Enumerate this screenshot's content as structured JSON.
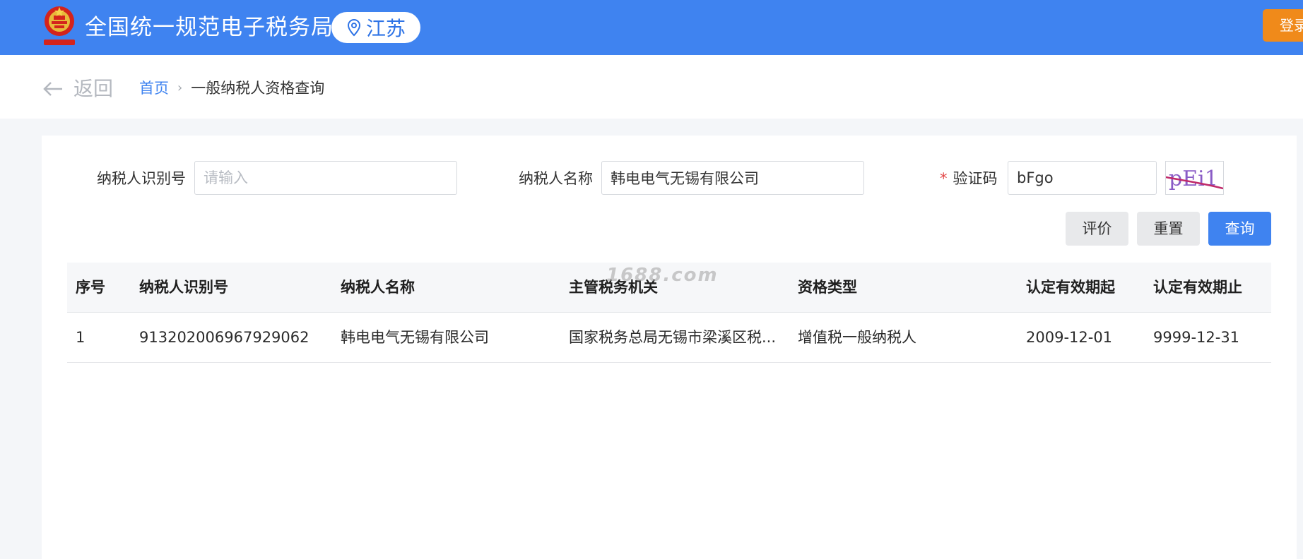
{
  "header": {
    "site_title": "全国统一规范电子税务局",
    "region": "江苏",
    "login_label": "登录"
  },
  "breadcrumb": {
    "back_label": "返回",
    "home_label": "首页",
    "separator": "›",
    "current_label": "一般纳税人资格查询"
  },
  "form": {
    "taxpayer_id": {
      "label": "纳税人识别号",
      "value": "",
      "placeholder": "请输入"
    },
    "taxpayer_name": {
      "label": "纳税人名称",
      "value": "韩电电气无锡有限公司"
    },
    "captcha": {
      "required_mark": "*",
      "label": "验证码",
      "value": "bFgo",
      "image_text": "pEi1"
    }
  },
  "buttons": {
    "evaluate": "评价",
    "reset": "重置",
    "query": "查询"
  },
  "table": {
    "headers": [
      "序号",
      "纳税人识别号",
      "纳税人名称",
      "主管税务机关",
      "资格类型",
      "认定有效期起",
      "认定有效期止"
    ],
    "rows": [
      [
        "1",
        "913202006967929062",
        "韩电电气无锡有限公司",
        "国家税务总局无锡市梁溪区税...",
        "增值税一般纳税人",
        "2009-12-01",
        "9999-12-31"
      ]
    ]
  },
  "watermark": "1688.com",
  "colors": {
    "header_blue": "#3f83f0",
    "login_orange": "#f08a1a",
    "required_red": "#e34848"
  }
}
